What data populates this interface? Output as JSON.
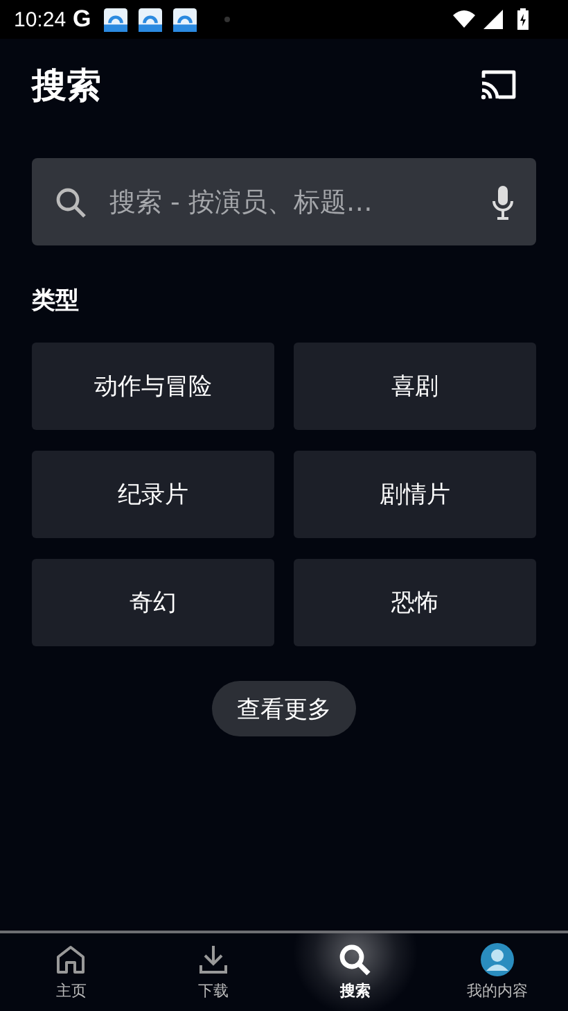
{
  "status_bar": {
    "time": "10:24",
    "carrier_glyph": "G"
  },
  "header": {
    "title": "搜索"
  },
  "search": {
    "placeholder": "搜索 - 按演员、标题…"
  },
  "genres": {
    "heading": "类型",
    "items": [
      "动作与冒险",
      "喜剧",
      "纪录片",
      "剧情片",
      "奇幻",
      "恐怖"
    ]
  },
  "more_button": "查看更多",
  "nav": [
    {
      "kind": "home",
      "label": "主页",
      "selected": false
    },
    {
      "kind": "download",
      "label": "下载",
      "selected": false
    },
    {
      "kind": "search",
      "label": "搜索",
      "selected": true
    },
    {
      "kind": "profile",
      "label": "我的内容",
      "selected": false
    }
  ]
}
